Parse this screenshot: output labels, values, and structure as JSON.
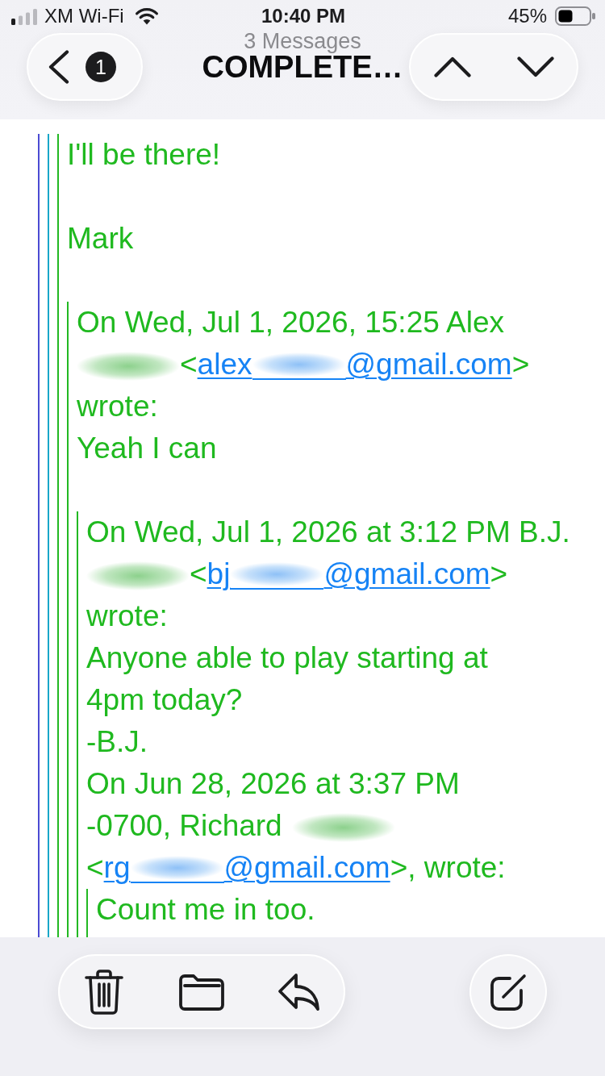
{
  "status_bar": {
    "carrier": "XM Wi-Fi",
    "time": "10:40 PM",
    "battery": "45%"
  },
  "nav_bar": {
    "back_badge": "1",
    "subtitle": "3 Messages",
    "title": "COMPLETE…"
  },
  "message_body": {
    "items": [
      {
        "kind": "quote",
        "items": [
          {
            "kind": "quote",
            "items": [
              {
                "kind": "quote",
                "items": [
                  {
                    "kind": "paragraph",
                    "lines": [
                      "I'll be there!"
                    ]
                  },
                  {
                    "kind": "blank"
                  },
                  {
                    "kind": "paragraph",
                    "lines": [
                      "Mark"
                    ]
                  },
                  {
                    "kind": "blank"
                  },
                  {
                    "kind": "quote",
                    "items": [
                      {
                        "kind": "paragraph",
                        "lines": [
                          "On Wed, Jul 1, 2026, 15:25 Alex",
                          [
                            {
                              "kind": "redaction"
                            },
                            {
                              "kind": "text",
                              "text": "<"
                            },
                            {
                              "kind": "email",
                              "start": "alex",
                              "end": "@gmail.com",
                              "redacted": true
                            },
                            {
                              "kind": "text",
                              "text": ">"
                            }
                          ],
                          "wrote:"
                        ]
                      },
                      {
                        "kind": "paragraph",
                        "lines": [
                          "Yeah I can"
                        ]
                      },
                      {
                        "kind": "blank"
                      },
                      {
                        "kind": "quote",
                        "items": [
                          {
                            "kind": "paragraph",
                            "lines": [
                              "On Wed, Jul 1, 2026 at 3:12 PM B.J.",
                              [
                                {
                                  "kind": "redaction"
                                },
                                {
                                  "kind": "text",
                                  "text": "<"
                                },
                                {
                                  "kind": "email",
                                  "start": "bj",
                                  "end": "@gmail.com",
                                  "redacted": true
                                },
                                {
                                  "kind": "text",
                                  "text": ">"
                                }
                              ],
                              "wrote:"
                            ]
                          },
                          {
                            "kind": "paragraph",
                            "lines": [
                              "Anyone able to play starting at",
                              "4pm today?"
                            ]
                          },
                          {
                            "kind": "paragraph",
                            "lines": [
                              "-B.J."
                            ]
                          },
                          {
                            "kind": "paragraph",
                            "lines": [
                              "On Jun 28, 2026 at 3:37 PM",
                              [
                                {
                                  "kind": "text",
                                  "text": "-0700, Richard"
                                },
                                {
                                  "kind": "redaction"
                                }
                              ],
                              [
                                {
                                  "kind": "text",
                                  "text": "<"
                                },
                                {
                                  "kind": "email",
                                  "start": "rg",
                                  "end": "@gmail.com",
                                  "redacted": true
                                },
                                {
                                  "kind": "text",
                                  "text": ">, wrote:"
                                }
                              ]
                            ]
                          },
                          {
                            "kind": "quote",
                            "items": [
                              {
                                "kind": "paragraph",
                                "lines": [
                                  "Count me in too."
                                ]
                              }
                            ]
                          }
                        ]
                      }
                    ]
                  }
                ]
              }
            ]
          }
        ]
      }
    ]
  }
}
